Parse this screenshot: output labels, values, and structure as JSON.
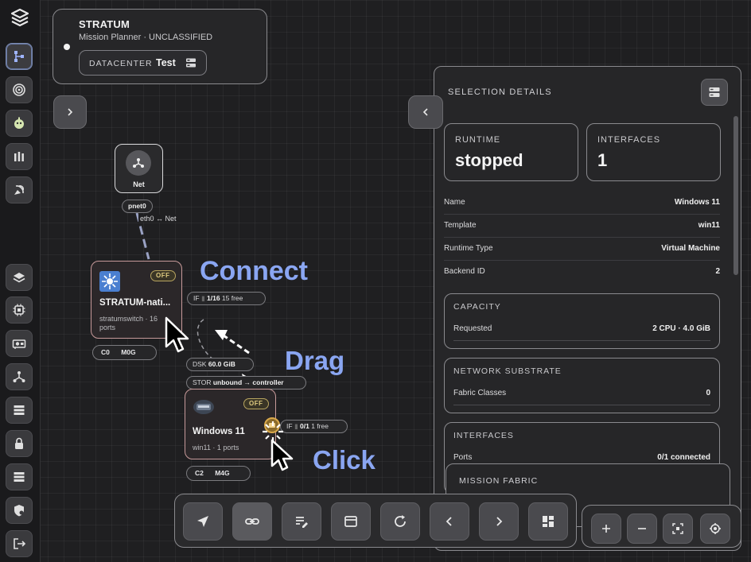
{
  "app": {
    "name": "STRATUM",
    "subtitle": "Mission Planner · UNCLASSIFIED",
    "datacenter_label": "DATACENTER",
    "datacenter_value": "Test"
  },
  "sidebar": {
    "items": [
      {
        "icon": "topology-icon",
        "active": true
      },
      {
        "icon": "target-icon"
      },
      {
        "icon": "bot-icon"
      },
      {
        "icon": "munitions-icon"
      },
      {
        "icon": "satellite-dish-icon"
      },
      {
        "icon": "layers-icon"
      },
      {
        "icon": "cpu-icon"
      },
      {
        "icon": "gpu-card-icon"
      },
      {
        "icon": "network-icon"
      },
      {
        "icon": "storage-icon"
      },
      {
        "icon": "lock-icon"
      },
      {
        "icon": "server-list-icon"
      },
      {
        "icon": "shield-icon"
      },
      {
        "icon": "logout-icon"
      }
    ]
  },
  "graph": {
    "net_node": {
      "label": "Net",
      "port": "pnet0",
      "edge_label": "eth0 ↔ Net"
    },
    "switch_node": {
      "status": "OFF",
      "title": "STRATUM-nati...",
      "subtitle": "stratumswitch · 16 ports",
      "resources": "C0 M0G",
      "if_prefix": "IF",
      "if_value": "1/16",
      "if_free": "15 free"
    },
    "vm_node": {
      "status": "OFF",
      "title": "Windows 11",
      "subtitle": "win11 · 1 ports",
      "resources": "C2 M4G",
      "if_prefix": "IF",
      "if_value": "0/1",
      "if_free": "1 free",
      "disk_prefix": "DSK",
      "disk_value": "60.0 GiB",
      "stor_prefix": "STOR",
      "stor_value": "unbound → controller"
    }
  },
  "annotations": {
    "connect": "Connect",
    "drag": "Drag",
    "click": "Click"
  },
  "selection": {
    "title": "SELECTION DETAILS",
    "runtime_label": "RUNTIME",
    "runtime_value": "stopped",
    "interfaces_label": "INTERFACES",
    "interfaces_value": "1",
    "fields": [
      {
        "key": "Name",
        "value": "Windows 11"
      },
      {
        "key": "Template",
        "value": "win11"
      },
      {
        "key": "Runtime Type",
        "value": "Virtual Machine"
      },
      {
        "key": "Backend ID",
        "value": "2"
      }
    ],
    "capacity": {
      "title": "CAPACITY",
      "key": "Requested",
      "value": "2 CPU · 4.0 GiB"
    },
    "network": {
      "title": "NETWORK SUBSTRATE",
      "key": "Fabric Classes",
      "value": "0"
    },
    "interfaces": {
      "title": "INTERFACES",
      "key": "Ports",
      "value": "0/1 connected"
    }
  },
  "fabric": {
    "title": "MISSION FABRIC"
  },
  "toolbar": {
    "buttons": [
      "navigate-icon",
      "link-icon",
      "edit-list-icon",
      "window-icon",
      "refresh-icon",
      "chevron-left-icon",
      "chevron-right-icon",
      "dashboard-icon"
    ]
  },
  "zoom": {
    "buttons": [
      "zoom-in-icon",
      "zoom-out-icon",
      "fit-view-icon",
      "locate-icon"
    ]
  }
}
